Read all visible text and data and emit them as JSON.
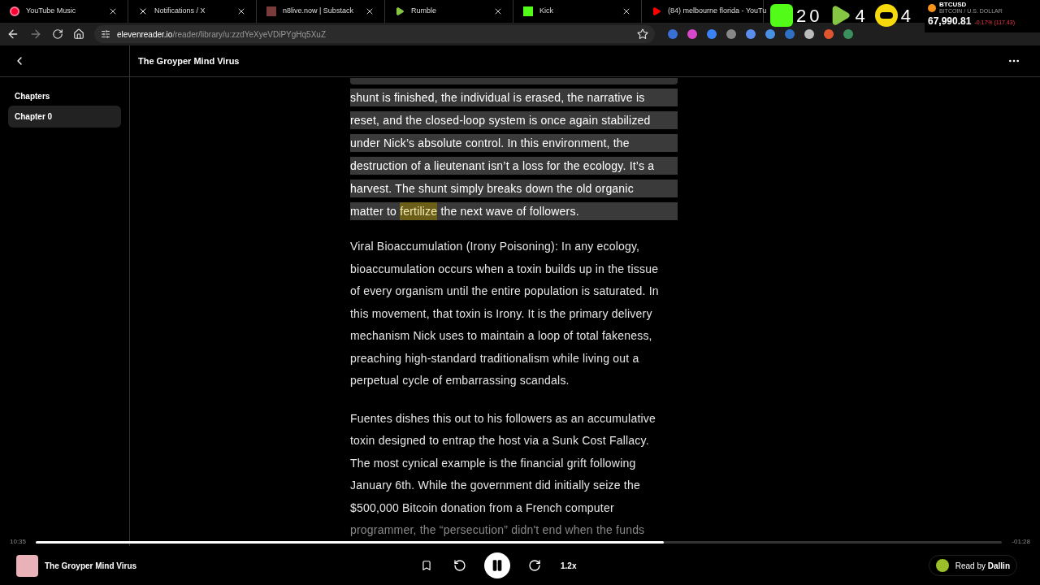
{
  "browser": {
    "tabs": [
      {
        "title": "YouTube Music"
      },
      {
        "title": "Notifications / X"
      },
      {
        "title": "n8live.now | Substack"
      },
      {
        "title": "Rumble"
      },
      {
        "title": "Kick"
      },
      {
        "title": "(84) melbourne florida - YouTu"
      }
    ],
    "url_host": "elevenreader.io",
    "url_path": "/reader/library/u:zzdYeXyeVDiPYgHq5XuZ",
    "overlay": {
      "counts": [
        {
          "kind": "kick",
          "value": "20"
        },
        {
          "kind": "rumble",
          "value": "4"
        },
        {
          "kind": "bot",
          "value": "4"
        }
      ]
    },
    "ticker": {
      "symbol": "BTCUSD",
      "name": "BITCOIN / U.S. DOLLAR",
      "price": "67,990.81",
      "change": "-0.17% (117.43)"
    }
  },
  "reader": {
    "title": "The Groyper Mind Virus",
    "sidebar": {
      "heading": "Chapters",
      "items": [
        {
          "label": "Chapter 0",
          "selected": true
        }
      ]
    },
    "current_paragraph": [
      [
        {
          "text": "shunt is finished, the individual is erased, the narrative is",
          "current": false
        }
      ],
      [
        {
          "text": "reset, and the closed-loop system is once again stabilized",
          "current": false
        }
      ],
      [
        {
          "text": "under Nick’s absolute control. In this environment, the",
          "current": false
        }
      ],
      [
        {
          "text": "destruction of a lieutenant isn’t a loss for the ecology. It’s a",
          "current": false
        }
      ],
      [
        {
          "text": "harvest. The shunt simply breaks down the old organic",
          "current": false
        }
      ],
      [
        {
          "text": "matter to ",
          "current": false
        },
        {
          "text": "fertilize",
          "current": true
        },
        {
          "text": " the next wave of followers.",
          "current": false
        }
      ]
    ],
    "paragraphs": [
      [
        "Viral Bioaccumulation (Irony Poisoning): In any ecology,",
        "bioaccumulation occurs when a toxin builds up in the tissue",
        "of every organism until the entire population is saturated. In",
        "this movement, that toxin is Irony. It is the primary delivery",
        "mechanism Nick uses to maintain a loop of total fakeness,",
        "preaching high-standard traditionalism while living out a",
        "perpetual cycle of embarrassing scandals."
      ],
      [
        "Fuentes dishes this out to his followers as an accumulative",
        "toxin designed to entrap the host via a Sunk Cost Fallacy.",
        "The most cynical example is the financial grift following",
        "January 6th. While the government did initially seize the",
        "$500,000 Bitcoin donation from a French computer",
        "programmer, the “persecution” didn't end when the funds"
      ]
    ]
  },
  "player": {
    "elapsed": "10:35",
    "remaining": "-01:28",
    "level": 0.65,
    "title": "The Groyper Mind Virus",
    "playing": true,
    "speed": "1.2x",
    "narrator_prefix": "Read by",
    "narrator": "Dallin"
  }
}
